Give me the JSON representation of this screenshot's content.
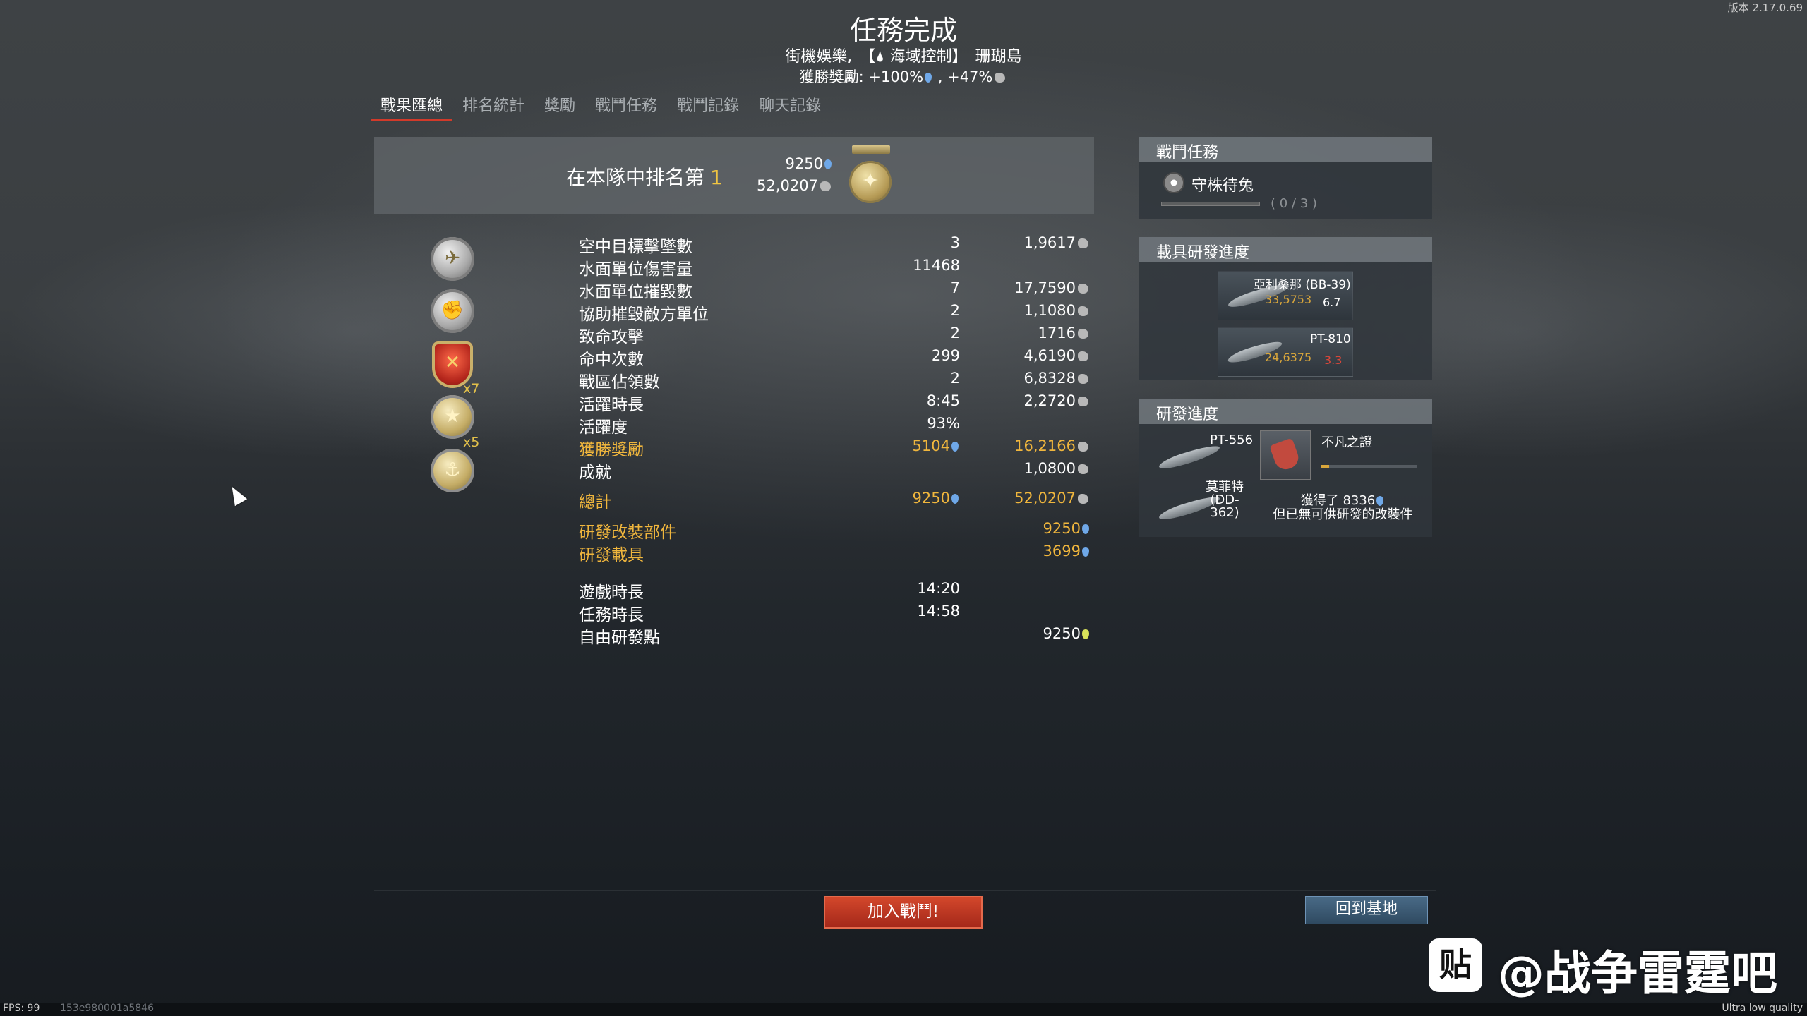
{
  "header": {
    "version": "版本 2.17.0.69",
    "title": "任務完成",
    "mode": "街機娛樂,",
    "mission": "【🌢 海域控制】",
    "map": "珊瑚島",
    "bonus_label": "獲勝獎勵:",
    "bonus_rp": "+100%",
    "bonus_sep": ",",
    "bonus_sl": "+47%"
  },
  "tabs": [
    {
      "label": "戰果匯總",
      "active": true
    },
    {
      "label": "排名統計"
    },
    {
      "label": "獎勵"
    },
    {
      "label": "戰鬥任務"
    },
    {
      "label": "戰鬥記錄"
    },
    {
      "label": "聊天記錄"
    }
  ],
  "rank": {
    "label": "在本隊中排名第",
    "position": "1",
    "rp": "9250",
    "sl": "52,0207"
  },
  "awards": {
    "multiplier_1": "x7",
    "multiplier_2": "x5"
  },
  "stats": [
    {
      "label": "空中目標擊墜數",
      "value": "3",
      "sl": "1,9617"
    },
    {
      "label": "水面單位傷害量",
      "value": "11468",
      "sl": ""
    },
    {
      "label": "水面單位摧毀數",
      "value": "7",
      "sl": "17,7590"
    },
    {
      "label": "協助摧毀敵方單位",
      "value": "2",
      "sl": "1,1080"
    },
    {
      "label": "致命攻擊",
      "value": "2",
      "sl": "1716"
    },
    {
      "label": "命中次數",
      "value": "299",
      "sl": "4,6190"
    },
    {
      "label": "戰區佔領數",
      "value": "2",
      "sl": "6,8328"
    },
    {
      "label": "活躍時長",
      "value": "8:45",
      "sl": "2,2720"
    },
    {
      "label": "活躍度",
      "value": "93%",
      "sl": ""
    },
    {
      "label": "獲勝獎勵",
      "value": "5104",
      "sl": "16,2166"
    },
    {
      "label": "成就",
      "value": "",
      "sl": "1,0800"
    }
  ],
  "totals": {
    "label": "總計",
    "rp": "9250",
    "sl": "52,0207",
    "mod_label": "研發改裝部件",
    "mod_rp": "9250",
    "veh_label": "研發載具",
    "veh_rp": "3699"
  },
  "times": {
    "game_label": "遊戲時長",
    "game": "14:20",
    "mission_label": "任務時長",
    "mission": "14:58",
    "frp_label": "自由研發點",
    "frp": "9250"
  },
  "panel_missions": {
    "title": "戰鬥任務",
    "name": "守株待兔",
    "count": "( 0 / 3 )",
    "progress": 0
  },
  "panel_vehicles": {
    "title": "載具研發進度",
    "items": [
      {
        "name": "亞利桑那 (BB-39)",
        "rp": "33,5753",
        "br": "6.7",
        "br_color": "#d9473a"
      },
      {
        "name": "PT-810",
        "rp": "24,6375",
        "br": "3.3",
        "br_color": "#d9473a"
      }
    ]
  },
  "panel_research": {
    "title": "研發進度",
    "ship_1": "PT-556",
    "ship_2": "莫菲特 (DD-362)",
    "mod_name": "不凡之證",
    "obtained": "獲得了 8336",
    "no_mods": "但已無可供研發的改裝件"
  },
  "buttons": {
    "join": "加入戰鬥!",
    "base": "回到基地"
  },
  "footer": {
    "fps": "FPS: 99",
    "session": "153e980001a5846",
    "quality": "Ultra low quality"
  },
  "watermark": {
    "logo": "贴",
    "text": "@战争雷霆吧"
  }
}
